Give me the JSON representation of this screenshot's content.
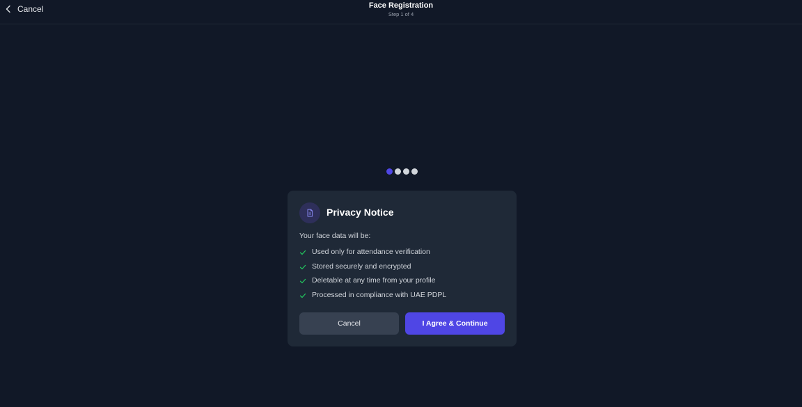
{
  "header": {
    "back_label": "Cancel",
    "title": "Face Registration",
    "subtitle": "Step 1 of 4"
  },
  "steps": {
    "current": 1,
    "total": 4,
    "active_color": "#4f46e5",
    "inactive_color": "#d1d5db"
  },
  "notice": {
    "icon": "document-icon",
    "title": "Privacy Notice",
    "intro": "Your face data will be:",
    "items": [
      "Used only for attendance verification",
      "Stored securely and encrypted",
      "Deletable at any time from your profile",
      "Processed in compliance with UAE PDPL"
    ],
    "check_color": "#22c55e",
    "cancel_label": "Cancel",
    "agree_label": "I Agree & Continue"
  },
  "colors": {
    "background": "#111827",
    "card": "#1f2937",
    "accent": "#4f46e5"
  }
}
